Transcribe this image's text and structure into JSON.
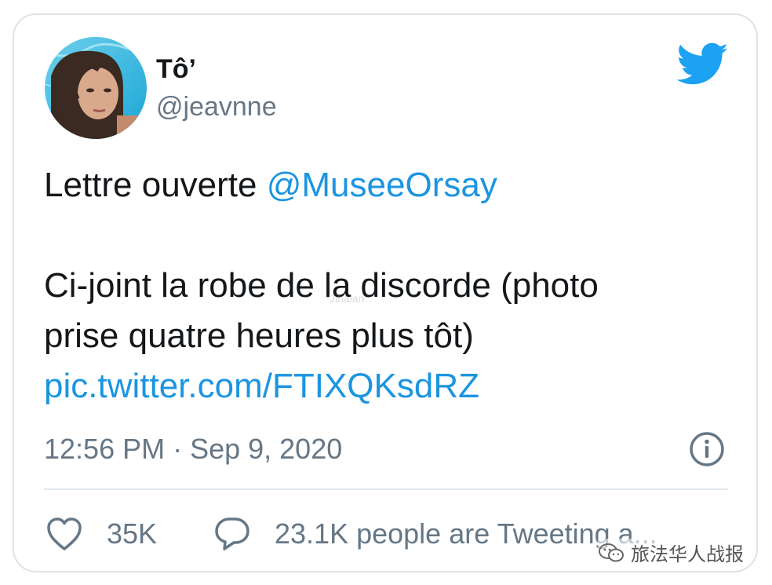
{
  "tweet": {
    "author": {
      "display_name": "Tô’",
      "handle": "@jeavnne",
      "avatar_icon": "user-avatar"
    },
    "text": {
      "prefix": "Lettre ouverte ",
      "mention": "@MuseeOrsay",
      "line2": "Ci-joint la robe de la discorde (photo",
      "line3": "prise quatre heures plus tôt)",
      "link": "pic.twitter.com/FTIXQKsdRZ"
    },
    "timestamp": "12:56 PM · Sep 9, 2020",
    "actions": {
      "likes": "35K",
      "tweeting": "23.1K people are Tweeting a..."
    }
  },
  "watermark": {
    "text": "旅法华人战报",
    "icon": "wechat-icon"
  },
  "colors": {
    "brand": "#1da1f2",
    "link": "#1b95e0",
    "text": "#14171a",
    "secondary": "#657786",
    "border": "#dfe3e6"
  }
}
